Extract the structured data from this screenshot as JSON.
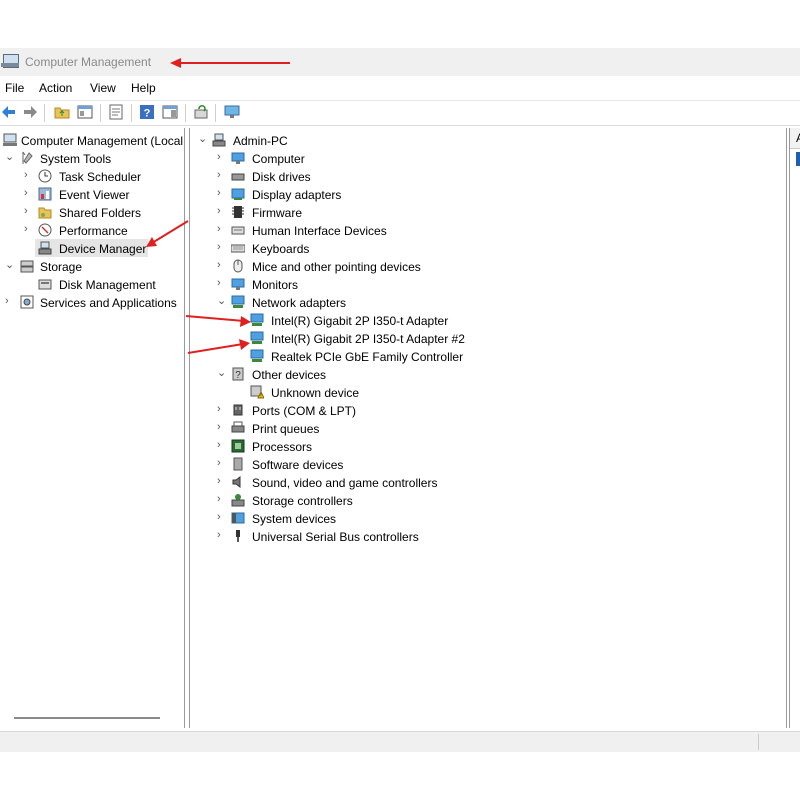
{
  "window": {
    "title": "Computer Management"
  },
  "menu": [
    "File",
    "Action",
    "View",
    "Help"
  ],
  "toolbar_icons": [
    "back-icon",
    "forward-icon",
    "up-folder-icon",
    "show-hide-console-tree-icon",
    "properties-icon",
    "help-icon",
    "action-pane-icon",
    "update-driver-icon",
    "monitor-icon"
  ],
  "left_tree": {
    "root": "Computer Management (Local",
    "system_tools": "System Tools",
    "task_scheduler": "Task Scheduler",
    "event_viewer": "Event Viewer",
    "shared_folders": "Shared Folders",
    "performance": "Performance",
    "device_manager": "Device Manager",
    "storage": "Storage",
    "disk_management": "Disk Management",
    "services_apps": "Services and Applications"
  },
  "device_tree": {
    "root": "Admin-PC",
    "categories": [
      "Computer",
      "Disk drives",
      "Display adapters",
      "Firmware",
      "Human Interface Devices",
      "Keyboards",
      "Mice and other pointing devices",
      "Monitors",
      "Network adapters",
      "Other devices",
      "Ports (COM & LPT)",
      "Print queues",
      "Processors",
      "Software devices",
      "Sound, video and game controllers",
      "Storage controllers",
      "System devices",
      "Universal Serial Bus controllers"
    ],
    "network_adapters": [
      "Intel(R) Gigabit 2P I350-t Adapter",
      "Intel(R) Gigabit 2P I350-t Adapter #2",
      "Realtek PCIe GbE Family Controller"
    ],
    "other_devices": [
      "Unknown device"
    ]
  },
  "right_column_header": "A",
  "colors": {
    "annotation_arrow": "#e02020",
    "selection": "#e5e5e5"
  }
}
